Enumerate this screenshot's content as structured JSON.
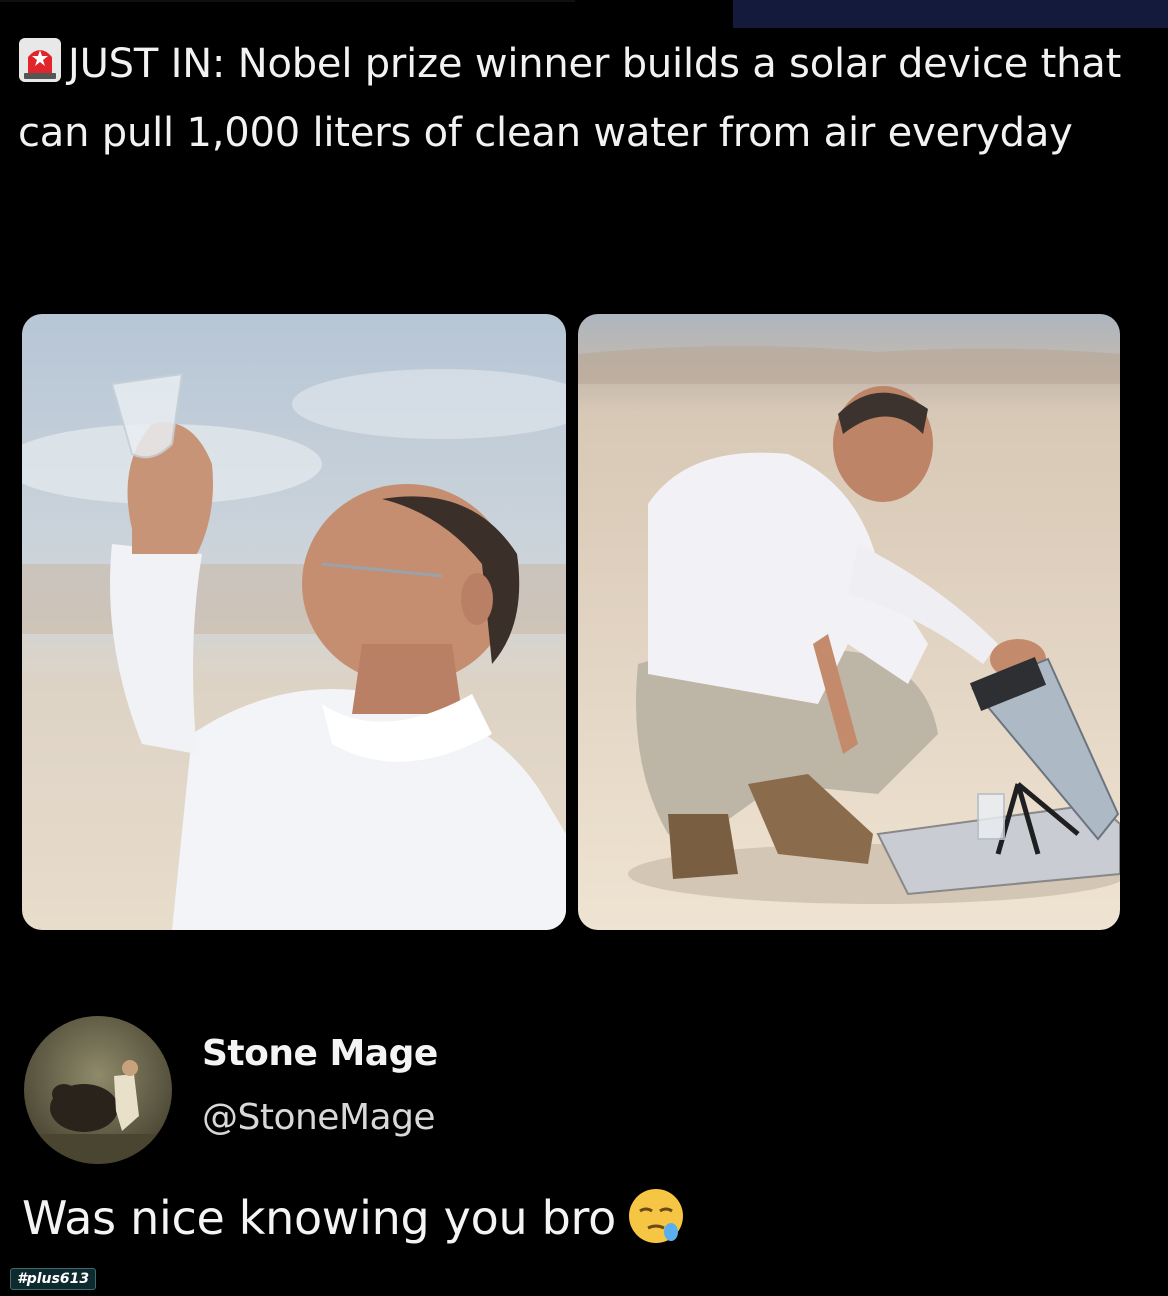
{
  "post": {
    "headline": "JUST IN: Nobel prize winner builds a solar device that can pull 1,000 liters of clean water from air everyday",
    "siren_icon": "siren-icon"
  },
  "images": {
    "left": {
      "icon": "photo-man-raising-glass"
    },
    "right": {
      "icon": "photo-man-kneeling-water-device"
    }
  },
  "reply": {
    "display_name": "Stone Mage",
    "handle": "@StoneMage",
    "text": "Was nice knowing you bro",
    "emoji_icon": "sleepy-face-icon",
    "avatar_icon": "avatar-bear-image"
  },
  "watermark": {
    "text": "#plus613"
  },
  "colors": {
    "background": "#000000",
    "text": "#f2f2f2",
    "handle": "#d8d8d8",
    "accent_bar": "#141a3c"
  }
}
